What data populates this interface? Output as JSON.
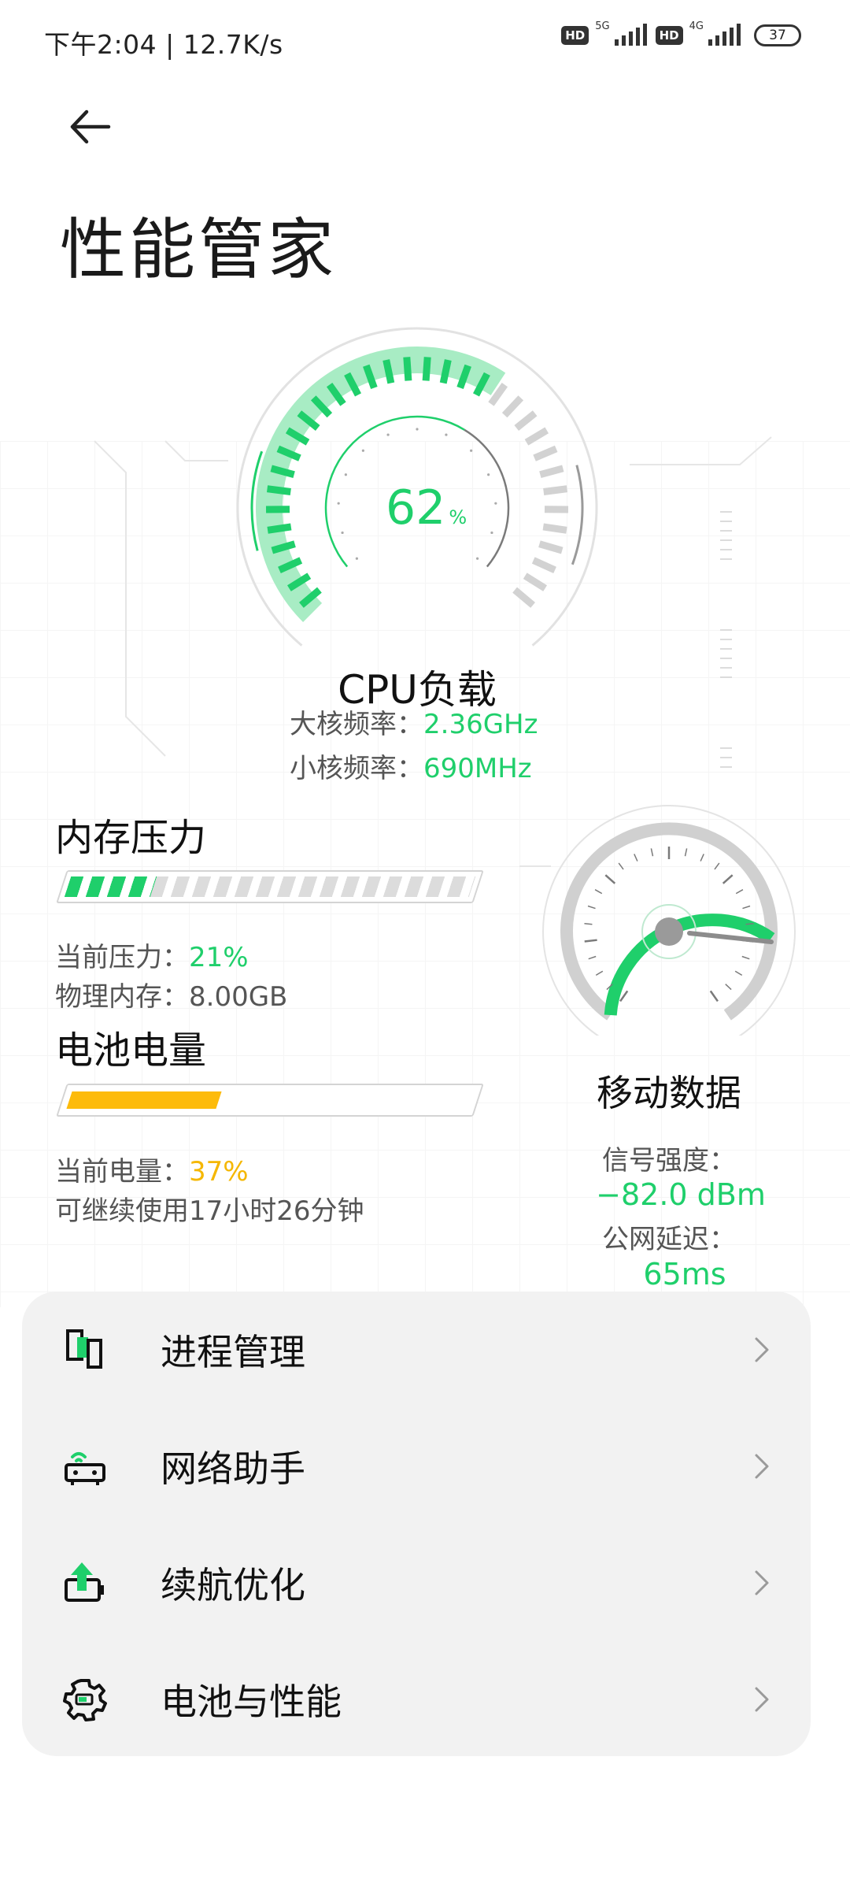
{
  "status_bar": {
    "time": "下午2:04",
    "speed": "12.7K/s",
    "hd1": "HD",
    "net1": "5G",
    "hd2": "HD",
    "net2": "4G",
    "battery": "37"
  },
  "header": {
    "title": "性能管家"
  },
  "cpu": {
    "value": "62",
    "unit": "%",
    "load_fraction": 0.62,
    "title": "CPU负载",
    "big_core_label": "大核频率：",
    "big_core_value": "2.36GHz",
    "little_core_label": "小核频率：",
    "little_core_value": "690MHz"
  },
  "memory": {
    "title": "内存压力",
    "pressure_label": "当前压力：",
    "pressure_value": "21%",
    "pressure_fraction": 0.21,
    "physical_label": "物理内存：",
    "physical_value": "8.00GB"
  },
  "battery": {
    "title": "电池电量",
    "level_label": "当前电量：",
    "level_value": "37%",
    "level_fraction": 0.37,
    "remaining": "可继续使用17小时26分钟"
  },
  "mobile_data": {
    "title": "移动数据",
    "signal_label": "信号强度：",
    "signal_value": "−82.0 dBm",
    "latency_label": "公网延迟：",
    "latency_value": "65ms"
  },
  "menu": {
    "items": [
      {
        "label": "进程管理",
        "icon": "process-icon"
      },
      {
        "label": "网络助手",
        "icon": "router-icon"
      },
      {
        "label": "续航优化",
        "icon": "battery-boost-icon"
      },
      {
        "label": "电池与性能",
        "icon": "gear-icon"
      }
    ]
  },
  "colors": {
    "accent_green": "#1fcf6b",
    "battery_amber": "#fdbb0b",
    "card_bg": "#f2f2f2"
  }
}
